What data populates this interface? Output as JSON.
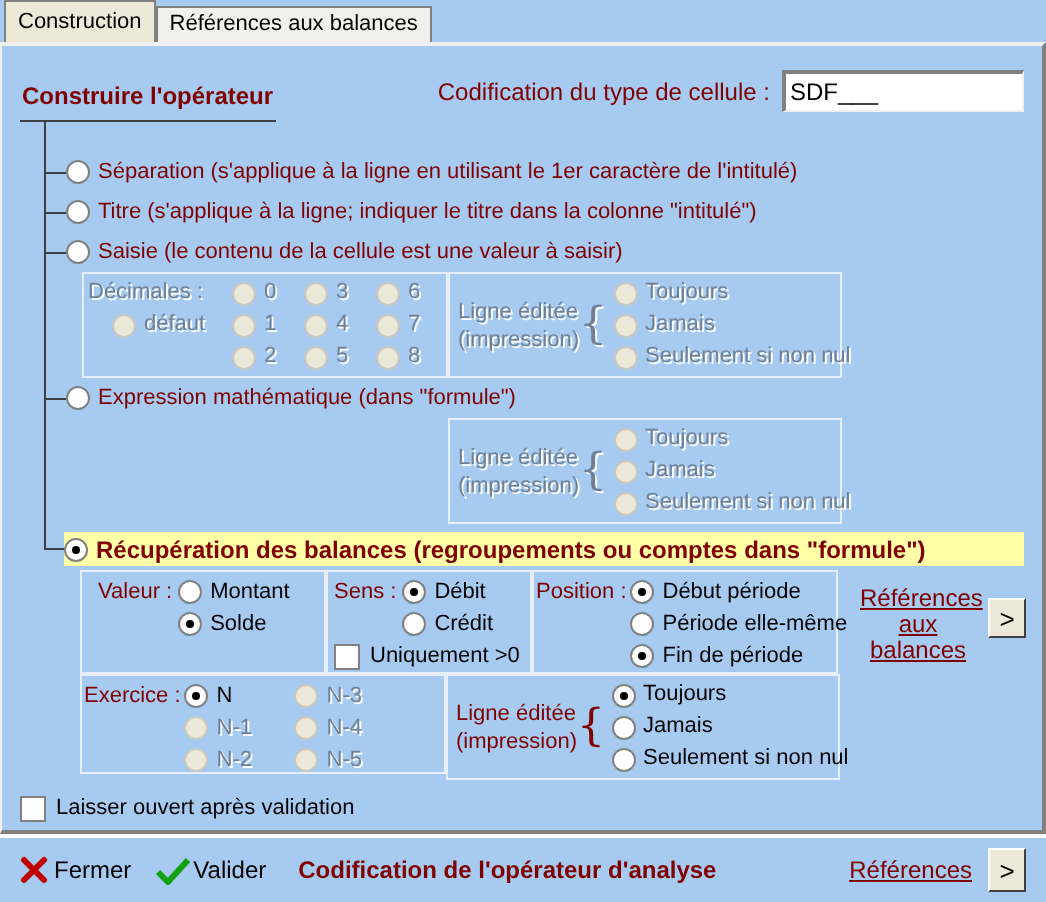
{
  "tabs": [
    {
      "label": "Construction",
      "selected": true
    },
    {
      "label": "Références aux balances",
      "selected": false
    }
  ],
  "section_title": "Construire l'opérateur",
  "cell_code": {
    "label": "Codification du type de cellule :",
    "value": "SDF___"
  },
  "operators": [
    {
      "label": "Séparation (s'applique à la ligne en utilisant le 1er caractère de l'intitulé)",
      "selected": false
    },
    {
      "label": "Titre (s'applique à la ligne; indiquer le titre dans la colonne \"intitulé\")",
      "selected": false
    },
    {
      "label": "Saisie (le contenu de la cellule est une valeur à saisir)",
      "selected": false
    },
    {
      "label": "Expression mathématique (dans \"formule\")",
      "selected": false
    },
    {
      "label": "Récupération des balances (regroupements ou comptes dans \"formule\")",
      "selected": true
    }
  ],
  "saisie": {
    "decimals_label": "Décimales :",
    "disabled": true,
    "default_option": {
      "label": "défaut",
      "selected": false
    },
    "options": [
      {
        "label": "0",
        "selected": false
      },
      {
        "label": "3",
        "selected": false
      },
      {
        "label": "6",
        "selected": false
      },
      {
        "label": "1",
        "selected": false
      },
      {
        "label": "4",
        "selected": false
      },
      {
        "label": "7",
        "selected": false
      },
      {
        "label": "2",
        "selected": false
      },
      {
        "label": "5",
        "selected": false
      },
      {
        "label": "8",
        "selected": false
      }
    ],
    "print_line": {
      "label_line1": "Ligne éditée",
      "label_line2": "(impression)",
      "brace": "{",
      "disabled": true,
      "options": [
        {
          "label": "Toujours",
          "selected": false
        },
        {
          "label": "Jamais",
          "selected": false
        },
        {
          "label": "Seulement si non nul",
          "selected": false
        }
      ]
    }
  },
  "expression": {
    "print_line": {
      "label_line1": "Ligne éditée",
      "label_line2": "(impression)",
      "brace": "{",
      "disabled": true,
      "options": [
        {
          "label": "Toujours",
          "selected": false
        },
        {
          "label": "Jamais",
          "selected": false
        },
        {
          "label": "Seulement si non nul",
          "selected": false
        }
      ]
    }
  },
  "recuperation": {
    "valeur": {
      "label": "Valeur :",
      "options": [
        {
          "label": "Montant",
          "selected": false
        },
        {
          "label": "Solde",
          "selected": true
        }
      ]
    },
    "sens": {
      "label": "Sens :",
      "options": [
        {
          "label": "Débit",
          "selected": true
        },
        {
          "label": "Crédit",
          "selected": false
        }
      ],
      "positive_only": {
        "label": "Uniquement >0",
        "checked": false
      }
    },
    "position": {
      "label": "Position :",
      "options": [
        {
          "label": "Début période",
          "selected": true
        },
        {
          "label": "Période elle-même",
          "selected": false
        },
        {
          "label": "Fin de période",
          "selected": true
        }
      ]
    },
    "references_link": "Références aux balances",
    "references_button": ">",
    "exercice": {
      "label": "Exercice :",
      "options": [
        {
          "label": "N",
          "selected": true,
          "disabled": false
        },
        {
          "label": "N-3",
          "selected": false,
          "disabled": true
        },
        {
          "label": "N-1",
          "selected": false,
          "disabled": true
        },
        {
          "label": "N-4",
          "selected": false,
          "disabled": true
        },
        {
          "label": "N-2",
          "selected": false,
          "disabled": true
        },
        {
          "label": "N-5",
          "selected": false,
          "disabled": true
        }
      ]
    },
    "print_line": {
      "label_line1": "Ligne éditée",
      "label_line2": "(impression)",
      "brace": "{",
      "disabled": false,
      "options": [
        {
          "label": "Toujours",
          "selected": true
        },
        {
          "label": "Jamais",
          "selected": false
        },
        {
          "label": "Seulement si non nul",
          "selected": false
        }
      ]
    }
  },
  "keep_open": {
    "label": "Laisser ouvert après validation",
    "checked": false
  },
  "footer": {
    "close": "Fermer",
    "validate": "Valider",
    "title": "Codification de l'opérateur d'analyse",
    "references_link": "Références",
    "next_button": ">"
  }
}
